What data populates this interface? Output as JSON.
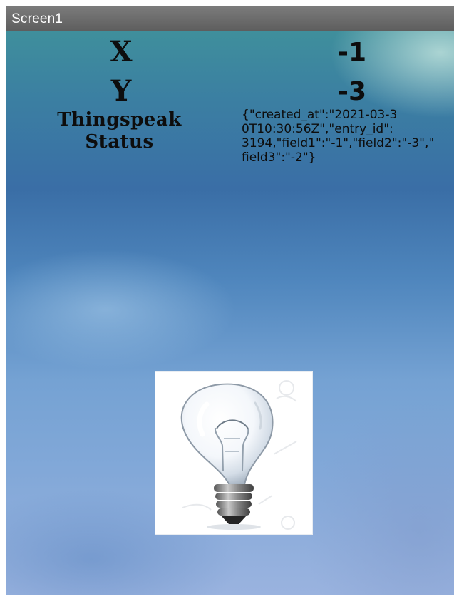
{
  "window": {
    "title": "Screen1"
  },
  "readings": {
    "x_label": "X",
    "x_value": "-1",
    "y_label": "Y",
    "y_value": "-3"
  },
  "status": {
    "label": "Thingspeak\nStatus",
    "value": "{\"created_at\":\"2021-03-3\n0T10:30:56Z\",\"entry_id\":\n3194,\"field1\":\"-1\",\"field2\":\"-3\",\"\nfield3\":\"-2\"}"
  },
  "colors": {
    "title_bar": "#6c6c6c",
    "background_top": "#3f8f9c",
    "background_bottom": "#9ab3df",
    "text": "#0d0d0d"
  },
  "icons": {
    "bulb": "light-bulb-icon"
  }
}
